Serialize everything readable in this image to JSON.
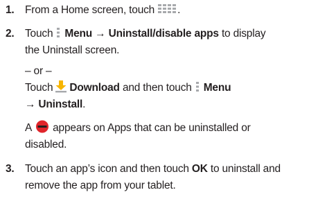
{
  "steps": [
    {
      "number": "1.",
      "text_before_icon": "From a Home screen, touch",
      "icon": "apps-grid-icon",
      "text_after_icon": "."
    },
    {
      "number": "2.",
      "line1_touch": "Touch",
      "line1_menu_icon": "menu-icon",
      "line1_menu_label": "Menu",
      "line1_arrow": "→",
      "line1_target": "Uninstall/disable apps",
      "line1_rest": "to display",
      "line2": "the Uninstall screen.",
      "or_text": "– or –",
      "alt_touch": "Touch",
      "alt_download_icon": "download-icon",
      "alt_download_label": "Download",
      "alt_mid": "and then touch",
      "alt_menu_icon": "menu-icon",
      "alt_menu_label": "Menu",
      "alt_arrow": "→",
      "alt_target": "Uninstall",
      "alt_end": ".",
      "note_prefix": "A",
      "note_icon": "uninstall-badge-icon",
      "note_line1": "appears on Apps that can be uninstalled or",
      "note_line2": "disabled."
    },
    {
      "number": "3.",
      "line1_prefix": "Touch an app’s icon and then touch",
      "ok_label": "OK",
      "line1_suffix": "to uninstall and",
      "line2": "remove the app from your tablet."
    }
  ],
  "colors": {
    "text": "#231f20",
    "icon_gray": "#a7a9ac",
    "download_arrow": "#f7b500",
    "badge_red": "#e0252b"
  }
}
